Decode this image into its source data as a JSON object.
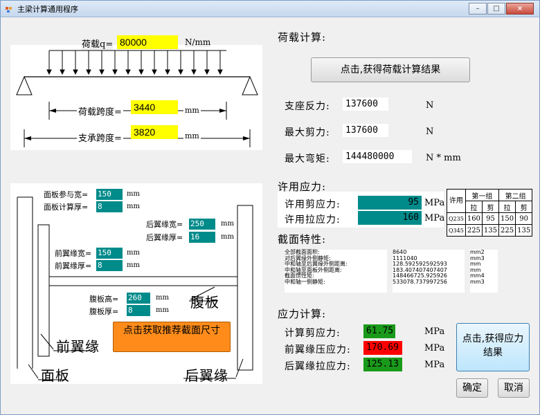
{
  "window": {
    "title": "主梁计算通用程序",
    "minimize": "–",
    "maximize": "□",
    "close": "×"
  },
  "load_diagram": {
    "load_label": "荷载q=",
    "load_value": "80000",
    "load_unit": "N/mm",
    "span_label": "荷载跨度=",
    "span_value": "3440",
    "span_unit": "mm",
    "support_label": "支承跨度=",
    "support_value": "3820",
    "support_unit": "mm"
  },
  "section_diagram": {
    "panel_ref_width_label": "面板参与宽=",
    "panel_ref_width_value": "150",
    "panel_ref_width_unit": "mm",
    "panel_thick_label": "面板计算厚=",
    "panel_thick_value": "8",
    "panel_thick_unit": "mm",
    "rear_width_label": "后翼缘宽=",
    "rear_width_value": "250",
    "rear_width_unit": "mm",
    "rear_thick_label": "后翼缘厚=",
    "rear_thick_value": "16",
    "rear_thick_unit": "mm",
    "front_width_label": "前翼缘宽=",
    "front_width_value": "150",
    "front_width_unit": "mm",
    "front_thick_label": "前翼缘厚=",
    "front_thick_value": "8",
    "front_thick_unit": "mm",
    "web_height_label": "腹板高=",
    "web_height_value": "260",
    "web_height_unit": "mm",
    "web_thick_label": "腹板厚=",
    "web_thick_value": "8",
    "web_thick_unit": "mm",
    "web_text": "腹板",
    "front_flange_text": "前翼缘",
    "panel_text": "面板",
    "rear_flange_text": "后翼缘",
    "recommend_button": "点击获取推荐截面尺寸"
  },
  "load_calc": {
    "title": "荷载计算:",
    "button": "点击,获得荷载计算结果",
    "reaction_label": "支座反力:",
    "reaction_value": "137600",
    "reaction_unit": "N",
    "shear_label": "最大剪力:",
    "shear_value": "137600",
    "shear_unit": "N",
    "moment_label": "最大弯矩:",
    "moment_value": "144480000",
    "moment_unit": "N * mm"
  },
  "allowable": {
    "title": "许用应力:",
    "shear_label": "许用剪应力:",
    "shear_value": "95",
    "shear_unit": "MPa",
    "tension_label": "许用拉应力:",
    "tension_value": "160",
    "tension_unit": "MPa",
    "table": {
      "corner": "许用",
      "group1": "第一组",
      "group2": "第二组",
      "sub": [
        "拉",
        "剪",
        "拉",
        "剪"
      ],
      "rows": [
        {
          "grade": "Q235",
          "values": [
            "160",
            "95",
            "150",
            "90"
          ]
        },
        {
          "grade": "Q345",
          "values": [
            "225",
            "135",
            "225",
            "135"
          ]
        }
      ]
    }
  },
  "section_props": {
    "title": "截面特性:",
    "rows": [
      {
        "label": "全部截面面积:",
        "value": "8640",
        "unit": "mm2"
      },
      {
        "label": "对后翼缘外侧静矩:",
        "value": "1111040",
        "unit": "mm3"
      },
      {
        "label": "中和轴至后翼缘外侧距离:",
        "value": "128.592592592593",
        "unit": "mm"
      },
      {
        "label": "中和轴至面板外侧距离:",
        "value": "183.407407407407",
        "unit": "mm"
      },
      {
        "label": "截面惯性矩:",
        "value": "148466725.925926",
        "unit": "mm4"
      },
      {
        "label": "中和轴一侧静矩:",
        "value": "533078.737997256",
        "unit": "mm3"
      }
    ]
  },
  "stress_calc": {
    "title": "应力计算:",
    "shear_label": "计算剪应力:",
    "shear_value": "61.75",
    "shear_unit": "MPa",
    "front_label": "前翼缘压应力:",
    "front_value": "170.69",
    "front_unit": "MPa",
    "rear_label": "后翼缘拉应力:",
    "rear_value": "125.13",
    "rear_unit": "MPa",
    "button": "点击,获得应力结果",
    "ok_button": "确定",
    "cancel_button": "取消"
  },
  "colors": {
    "yellow": "#ffff00",
    "teal": "#008b8b",
    "ok_green": "#1a9a1a",
    "fail_red": "#ff0000"
  }
}
